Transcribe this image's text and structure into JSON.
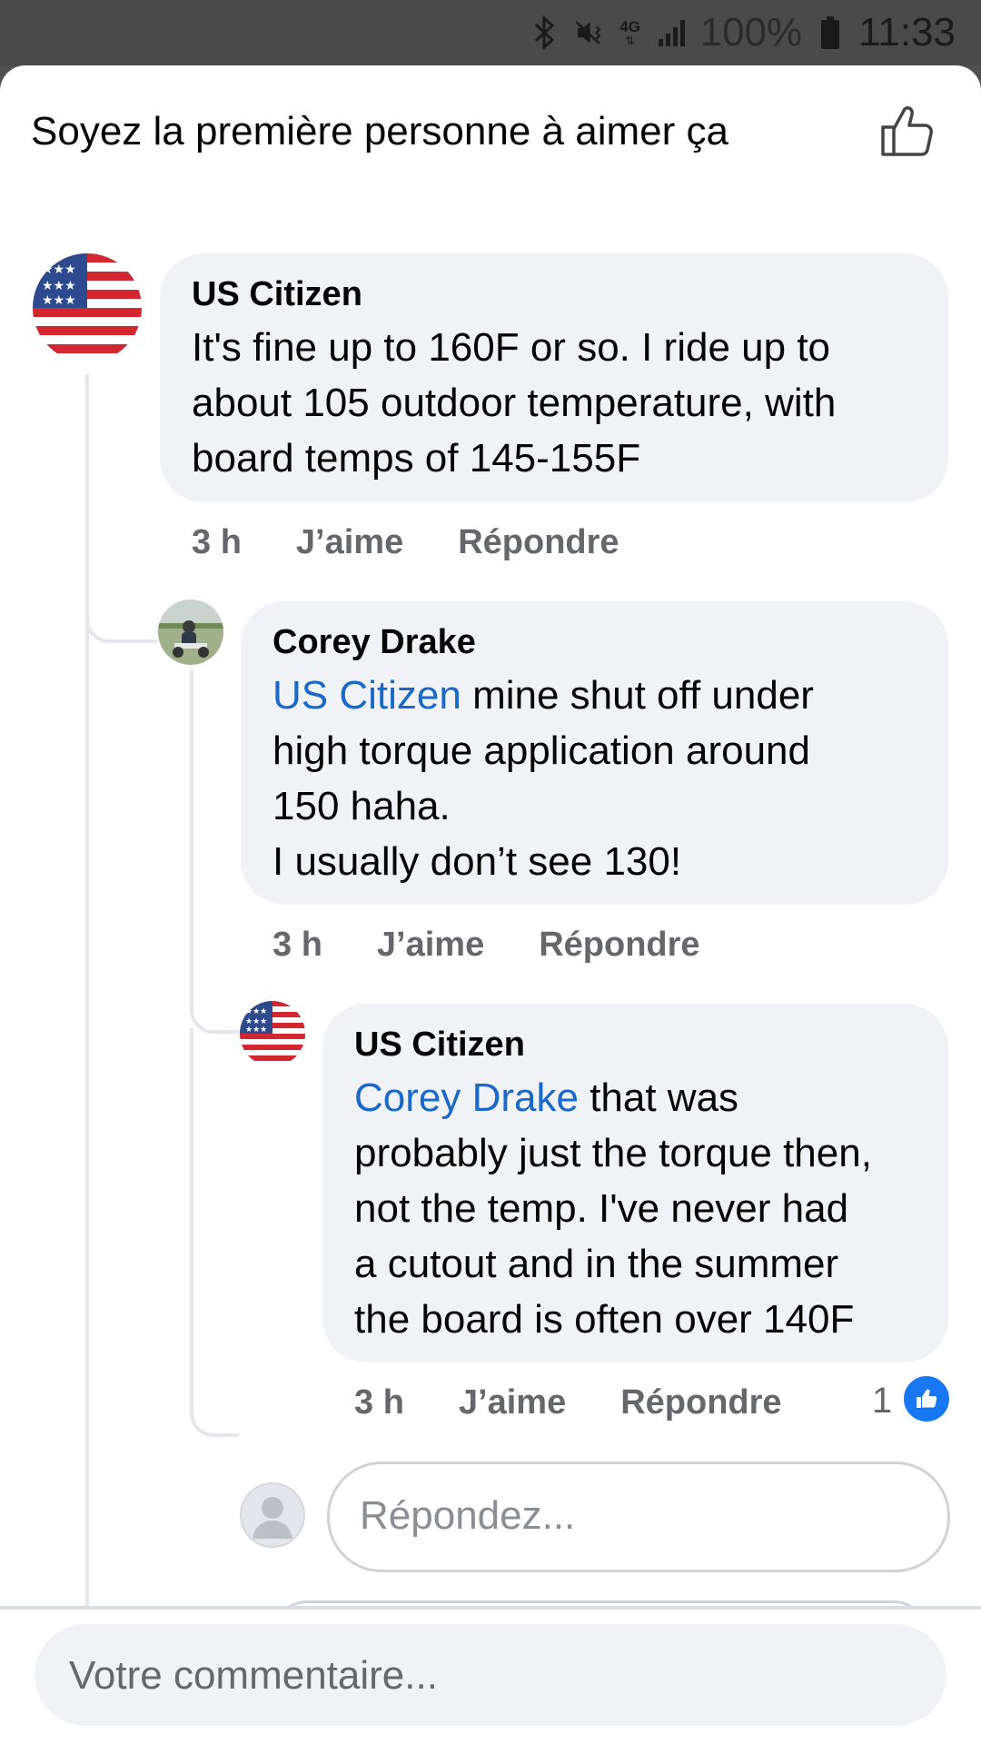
{
  "status_bar": {
    "network": "4G",
    "battery": "100%",
    "time": "11:33"
  },
  "header": {
    "title": "Soyez la première personne à aimer ça"
  },
  "comments": [
    {
      "author": "US Citizen",
      "mention": "",
      "text_lines": [
        "It's fine up to 160F or so. I ride up to",
        "about 105 outdoor temperature, with",
        "board temps of 145-155F"
      ],
      "time": "3 h",
      "like_label": "J’aime",
      "reply_label": "Répondre"
    },
    {
      "author": "Corey Drake",
      "mention": "US Citizen",
      "first_line_rest": " mine shut off under",
      "text_lines": [
        "high torque application around",
        "150 haha.",
        "I usually don’t see 130!"
      ],
      "time": "3 h",
      "like_label": "J’aime",
      "reply_label": "Répondre"
    },
    {
      "author": "US Citizen",
      "mention": "Corey Drake",
      "first_line_rest": " that was",
      "text_lines": [
        "probably just the torque then,",
        "not the temp. I've never had",
        "a cutout and in the summer",
        "the board is often over 140F"
      ],
      "time": "3 h",
      "like_label": "J’aime",
      "reply_label": "Répondre",
      "reaction_count": "1"
    }
  ],
  "reply_input": {
    "placeholder": "Répondez..."
  },
  "composer": {
    "placeholder": "Votre commentaire..."
  },
  "colors": {
    "mention": "#1a68c9",
    "bubble": "#f0f2f5",
    "secondary_text": "#65676b",
    "like_blue": "#1877f2"
  }
}
